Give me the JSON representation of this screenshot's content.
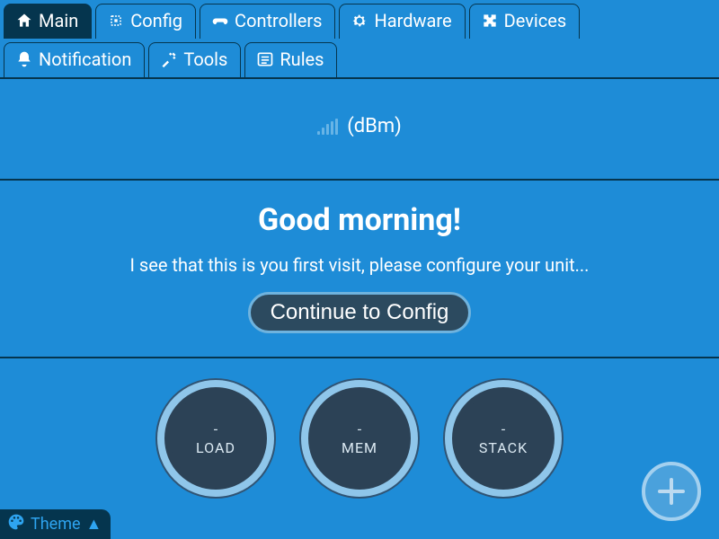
{
  "tabs": {
    "main": "Main",
    "config": "Config",
    "controllers": "Controllers",
    "hardware": "Hardware",
    "devices": "Devices",
    "notification": "Notification",
    "tools": "Tools",
    "rules": "Rules"
  },
  "signal": {
    "label": "(dBm)"
  },
  "welcome": {
    "title": "Good morning!",
    "body": "I see that this is you first visit, please configure your unit...",
    "button": "Continue to Config"
  },
  "gauges": {
    "load": {
      "value": "-",
      "label": "LOAD"
    },
    "mem": {
      "value": "-",
      "label": "MEM"
    },
    "stack": {
      "value": "-",
      "label": "STACK"
    }
  },
  "theme": {
    "label": "Theme",
    "arrow": "▲"
  }
}
